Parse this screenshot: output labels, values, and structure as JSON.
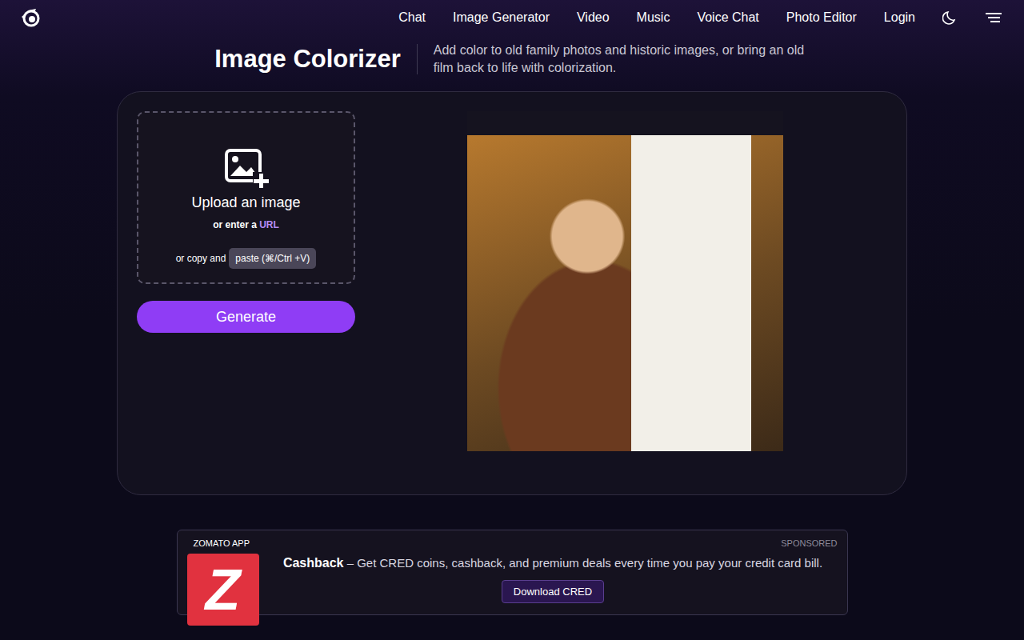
{
  "nav": {
    "links": [
      "Chat",
      "Image Generator",
      "Video",
      "Music",
      "Voice Chat",
      "Photo Editor",
      "Login"
    ]
  },
  "header": {
    "title": "Image Colorizer",
    "description": "Add color to old family photos and historic images, or bring an old film back to life with colorization."
  },
  "upload": {
    "title": "Upload an image",
    "url_prefix": "or enter a",
    "url_link": "URL",
    "paste_prefix": "or copy and",
    "paste_key": "paste (⌘/Ctrl +V)"
  },
  "generate_button": "Generate",
  "ad": {
    "brand": "ZOMATO APP",
    "label": "SPONSORED",
    "logo": "Z",
    "title": "Cashback",
    "text": "– Get CRED coins, cashback, and premium deals every time you pay your credit card bill.",
    "button": "Download CRED"
  }
}
